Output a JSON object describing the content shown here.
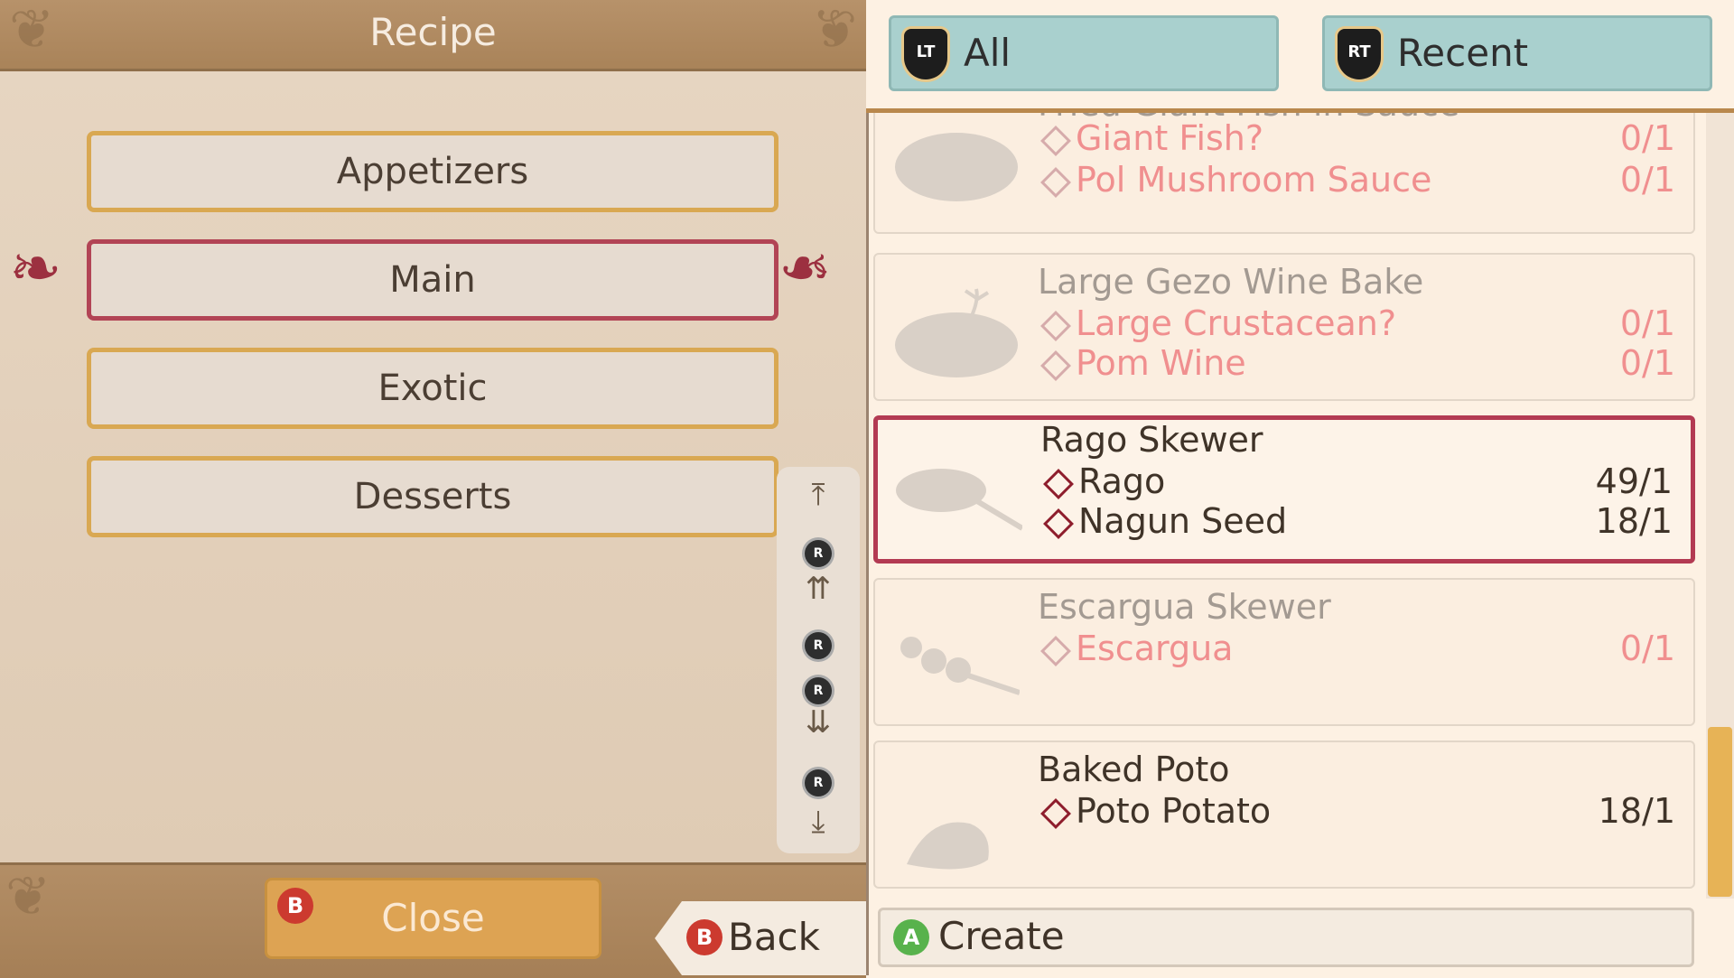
{
  "header": {
    "title": "Recipe"
  },
  "categories": [
    {
      "label": "Appetizers",
      "selected": false
    },
    {
      "label": "Main",
      "selected": true
    },
    {
      "label": "Exotic",
      "selected": false
    },
    {
      "label": "Desserts",
      "selected": false
    }
  ],
  "scroll_controls": {
    "top_icon": "jump-to-top-icon",
    "page_up_icon": "double-up-icon",
    "page_down_icon": "double-down-icon",
    "bottom_icon": "jump-to-bottom-icon",
    "stick_label": "R"
  },
  "footer": {
    "close_button": {
      "badge": "B",
      "label": "Close"
    },
    "back_button": {
      "badge": "B",
      "label": "Back"
    }
  },
  "tabs": [
    {
      "badge": "LT",
      "label": "All"
    },
    {
      "badge": "RT",
      "label": "Recent"
    }
  ],
  "recipes": [
    {
      "name": "Fried Giant Fish in Sauce",
      "available": false,
      "ingredients": [
        {
          "name": "Giant Fish?",
          "qty": "0/1"
        },
        {
          "name": "Pol Mushroom Sauce",
          "qty": "0/1"
        }
      ]
    },
    {
      "name": "Large Gezo Wine Bake",
      "available": false,
      "ingredients": [
        {
          "name": "Large Crustacean?",
          "qty": "0/1"
        },
        {
          "name": "Pom Wine",
          "qty": "0/1"
        }
      ]
    },
    {
      "name": "Rago Skewer",
      "available": true,
      "selected": true,
      "ingredients": [
        {
          "name": "Rago",
          "qty": "49/1"
        },
        {
          "name": "Nagun Seed",
          "qty": "18/1"
        }
      ]
    },
    {
      "name": "Escargua Skewer",
      "available": false,
      "ingredients": [
        {
          "name": "Escargua",
          "qty": "0/1"
        }
      ]
    },
    {
      "name": "Baked Poto",
      "available": true,
      "ingredients": [
        {
          "name": "Poto Potato",
          "qty": "18/1"
        }
      ]
    }
  ],
  "create_button": {
    "badge": "A",
    "label": "Create"
  },
  "colors": {
    "selected_border": "#b33a52",
    "category_border": "#d9a852",
    "tab_bg": "#a9d0ce",
    "missing_ingredient": "#f08f8f",
    "close_button_bg": "#dda353"
  }
}
